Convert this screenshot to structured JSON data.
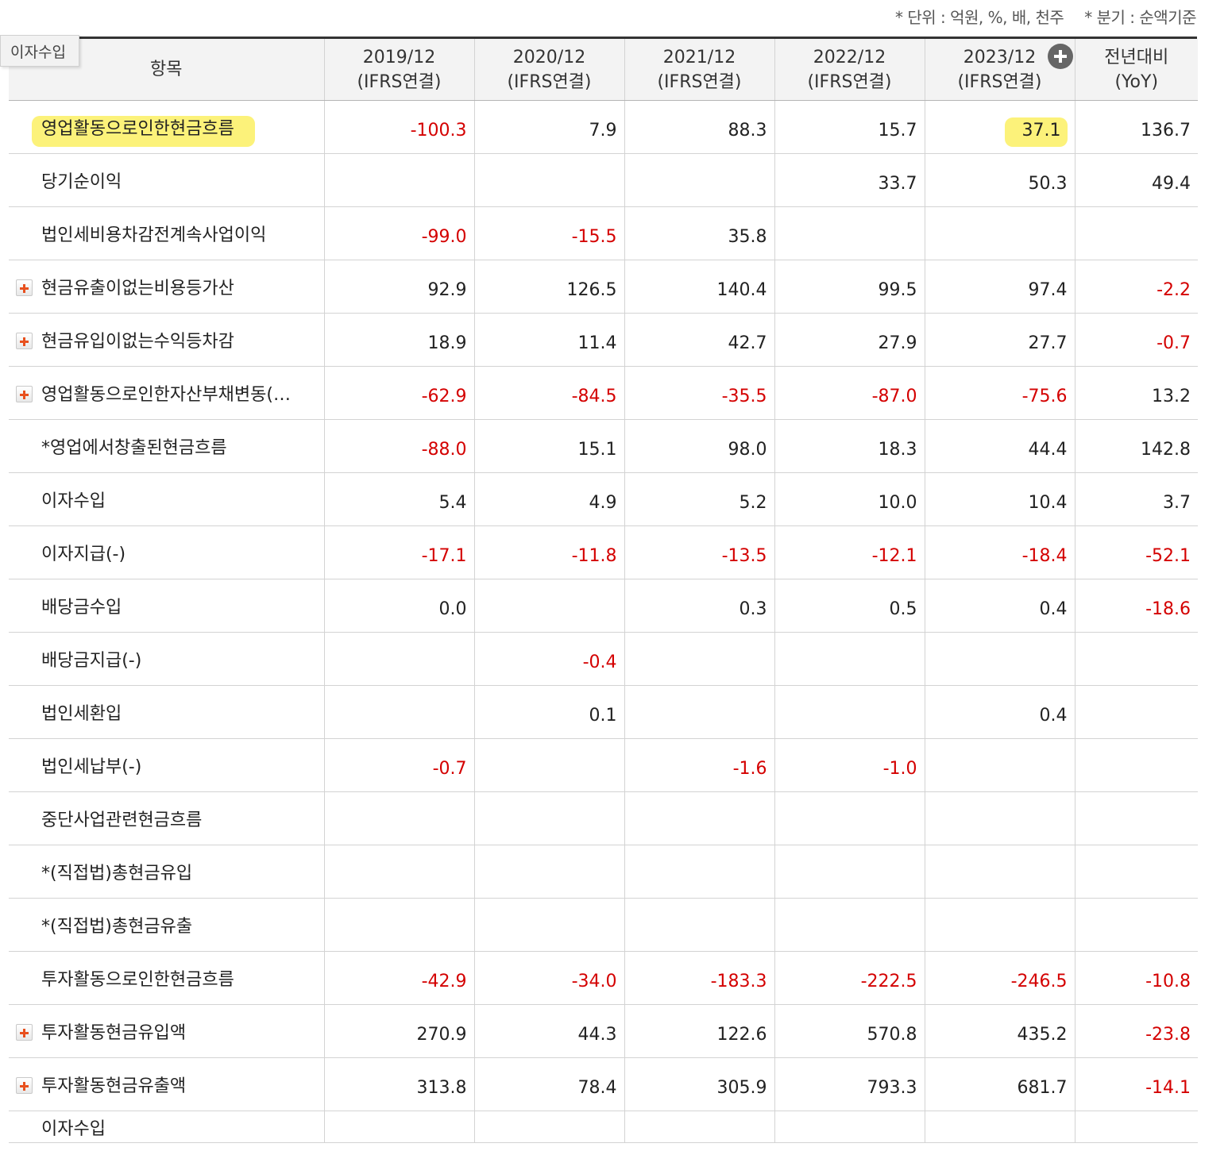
{
  "unit_note": {
    "unit": "* 단위 : 억원, %, 배, 천주",
    "basis": "* 분기 : 순액기준"
  },
  "tooltip": "이자수입",
  "header": {
    "item": "항목",
    "periods": [
      {
        "year": "2019/12",
        "basis": "(IFRS연결)"
      },
      {
        "year": "2020/12",
        "basis": "(IFRS연결)"
      },
      {
        "year": "2021/12",
        "basis": "(IFRS연결)"
      },
      {
        "year": "2022/12",
        "basis": "(IFRS연결)"
      },
      {
        "year": "2023/12",
        "basis": "(IFRS연결)"
      }
    ],
    "yoy": {
      "line1": "전년대비",
      "line2": "(YoY)"
    }
  },
  "colors": {
    "negative": "#d40000",
    "highlight": "#fcf27a",
    "expand": "#e8501e"
  },
  "rows": [
    {
      "label": "영업활동으로인한현금흐름",
      "expandable": false,
      "values": [
        "-100.3",
        "7.9",
        "88.3",
        "15.7",
        "37.1",
        "136.7"
      ]
    },
    {
      "label": "당기순이익",
      "expandable": false,
      "values": [
        "",
        "",
        "",
        "33.7",
        "50.3",
        "49.4"
      ]
    },
    {
      "label": "법인세비용차감전계속사업이익",
      "expandable": false,
      "values": [
        "-99.0",
        "-15.5",
        "35.8",
        "",
        "",
        ""
      ]
    },
    {
      "label": "현금유출이없는비용등가산",
      "expandable": true,
      "values": [
        "92.9",
        "126.5",
        "140.4",
        "99.5",
        "97.4",
        "-2.2"
      ]
    },
    {
      "label": "현금유입이없는수익등차감",
      "expandable": true,
      "values": [
        "18.9",
        "11.4",
        "42.7",
        "27.9",
        "27.7",
        "-0.7"
      ]
    },
    {
      "label": "영업활동으로인한자산부채변동(…",
      "expandable": true,
      "values": [
        "-62.9",
        "-84.5",
        "-35.5",
        "-87.0",
        "-75.6",
        "13.2"
      ]
    },
    {
      "label": "*영업에서창출된현금흐름",
      "expandable": false,
      "values": [
        "-88.0",
        "15.1",
        "98.0",
        "18.3",
        "44.4",
        "142.8"
      ]
    },
    {
      "label": "이자수입",
      "expandable": false,
      "values": [
        "5.4",
        "4.9",
        "5.2",
        "10.0",
        "10.4",
        "3.7"
      ]
    },
    {
      "label": "이자지급(-)",
      "expandable": false,
      "values": [
        "-17.1",
        "-11.8",
        "-13.5",
        "-12.1",
        "-18.4",
        "-52.1"
      ]
    },
    {
      "label": "배당금수입",
      "expandable": false,
      "values": [
        "0.0",
        "",
        "0.3",
        "0.5",
        "0.4",
        "-18.6"
      ]
    },
    {
      "label": "배당금지급(-)",
      "expandable": false,
      "values": [
        "",
        "-0.4",
        "",
        "",
        "",
        ""
      ]
    },
    {
      "label": "법인세환입",
      "expandable": false,
      "values": [
        "",
        "0.1",
        "",
        "",
        "0.4",
        ""
      ]
    },
    {
      "label": "법인세납부(-)",
      "expandable": false,
      "values": [
        "-0.7",
        "",
        "-1.6",
        "-1.0",
        "",
        ""
      ]
    },
    {
      "label": "중단사업관련현금흐름",
      "expandable": false,
      "values": [
        "",
        "",
        "",
        "",
        "",
        ""
      ]
    },
    {
      "label": "*(직접법)총현금유입",
      "expandable": false,
      "values": [
        "",
        "",
        "",
        "",
        "",
        ""
      ]
    },
    {
      "label": "*(직접법)총현금유출",
      "expandable": false,
      "values": [
        "",
        "",
        "",
        "",
        "",
        ""
      ]
    },
    {
      "label": "투자활동으로인한현금흐름",
      "expandable": false,
      "values": [
        "-42.9",
        "-34.0",
        "-183.3",
        "-222.5",
        "-246.5",
        "-10.8"
      ]
    },
    {
      "label": "투자활동현금유입액",
      "expandable": true,
      "values": [
        "270.9",
        "44.3",
        "122.6",
        "570.8",
        "435.2",
        "-23.8"
      ]
    },
    {
      "label": "투자활동현금유출액",
      "expandable": true,
      "values": [
        "313.8",
        "78.4",
        "305.9",
        "793.3",
        "681.7",
        "-14.1"
      ]
    },
    {
      "label": "이자수입",
      "expandable": false,
      "values": [
        "",
        "",
        "",
        "",
        "",
        ""
      ]
    }
  ]
}
